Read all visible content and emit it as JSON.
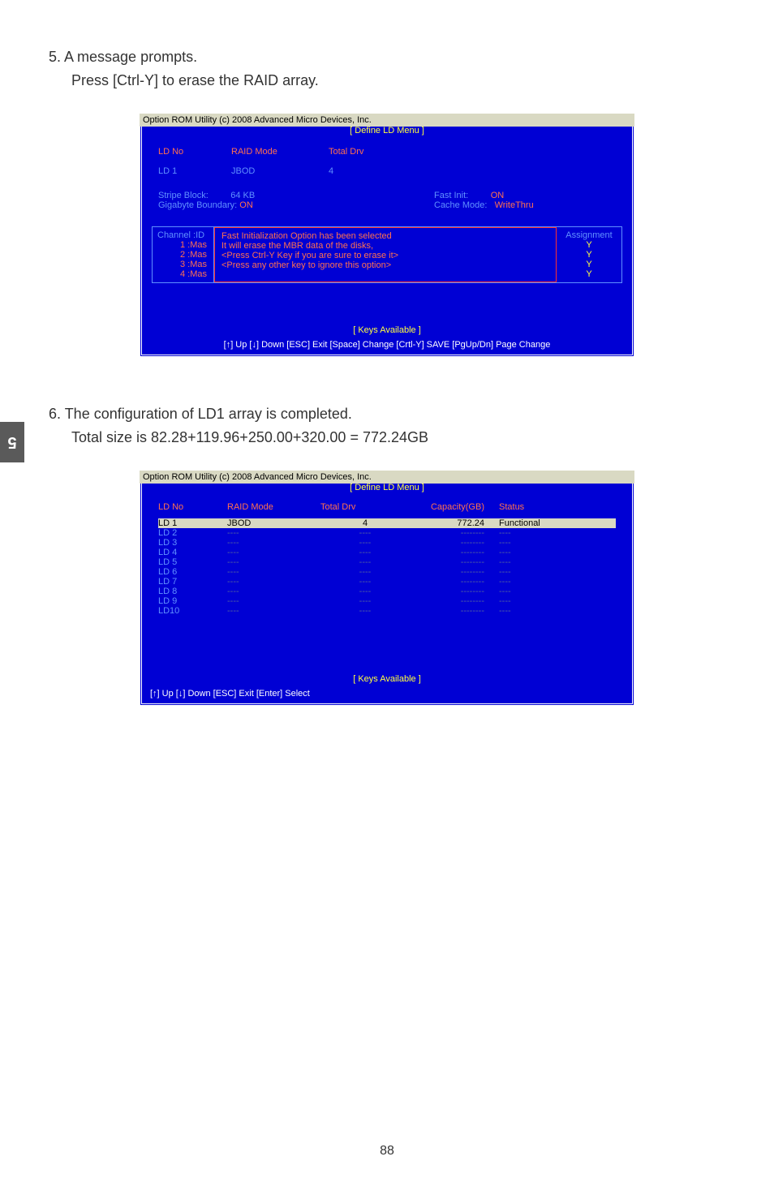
{
  "sideTab": "5",
  "step5": {
    "title": "5. A message prompts.",
    "instruction": "Press [Ctrl-Y] to erase the RAID array."
  },
  "bios1": {
    "title": "Option ROM Utility (c) 2008 Advanced Micro Devices, Inc.",
    "menuLabel": "[ Define LD Menu ]",
    "header": {
      "c1": "LD No",
      "c2": "RAID Mode",
      "c3": "Total Drv"
    },
    "row": {
      "c1": "LD  1",
      "c2": "JBOD",
      "c3": "4"
    },
    "settings": {
      "stripeLabel": "Stripe Block:",
      "stripeVal": "64   KB",
      "gigLabel": "Gigabyte Boundary:",
      "gigVal": "ON",
      "fastLabel": "Fast Init:",
      "fastVal": "ON",
      "cacheLabel": "Cache Mode:",
      "cacheVal": "WriteThru"
    },
    "channel": {
      "header": "Channel  :ID",
      "rows": [
        "1 :Mas",
        "2 :Mas",
        "3 :Mas",
        "4 :Mas"
      ]
    },
    "dialog": {
      "l1": "Fast Initialization Option has been selected",
      "l2": "It will erase the MBR data of the disks,",
      "l3": "<Press Ctrl-Y Key if you are sure to erase it>",
      "l4": "<Press any other key to ignore this option>"
    },
    "assign": {
      "header": "Assignment",
      "vals": [
        "Y",
        "Y",
        "Y",
        "Y"
      ]
    },
    "keysLabel": "[ Keys Available ]",
    "footer": "[↑] Up  [↓] Down  [ESC] Exit  [Space] Change  [Crtl-Y] SAVE   [PgUp/Dn] Page Change"
  },
  "step6": {
    "title": "6. The configuration of LD1 array is completed.",
    "instruction": "Total size is 82.28+119.96+250.00+320.00 = 772.24GB"
  },
  "bios2": {
    "title": "Option ROM Utility (c) 2008 Advanced Micro Devices, Inc.",
    "menuLabel": "[ Define LD Menu ]",
    "header": {
      "c1": "LD No",
      "c2": "RAID Mode",
      "c3": "Total Drv",
      "c4": "Capacity(GB)",
      "c5": "Status"
    },
    "rows": [
      {
        "id": "LD  1",
        "mode": "JBOD",
        "drv": "4",
        "cap": "772.24",
        "status": "Functional",
        "sel": true
      },
      {
        "id": "LD  2",
        "mode": "----",
        "drv": "----",
        "cap": "--------",
        "status": "----"
      },
      {
        "id": "LD  3",
        "mode": "----",
        "drv": "----",
        "cap": "--------",
        "status": "----"
      },
      {
        "id": "LD  4",
        "mode": "----",
        "drv": "----",
        "cap": "--------",
        "status": "----"
      },
      {
        "id": "LD  5",
        "mode": "----",
        "drv": "----",
        "cap": "--------",
        "status": "----"
      },
      {
        "id": "LD  6",
        "mode": "----",
        "drv": "----",
        "cap": "--------",
        "status": "----"
      },
      {
        "id": "LD  7",
        "mode": "----",
        "drv": "----",
        "cap": "--------",
        "status": "----"
      },
      {
        "id": "LD  8",
        "mode": "----",
        "drv": "----",
        "cap": "--------",
        "status": "----"
      },
      {
        "id": "LD  9",
        "mode": "----",
        "drv": "----",
        "cap": "--------",
        "status": "----"
      },
      {
        "id": "LD10",
        "mode": "----",
        "drv": "----",
        "cap": "--------",
        "status": "----"
      }
    ],
    "keysLabel": "[ Keys Available ]",
    "footer": "[↑] Up     [↓] Down     [ESC] Exit     [Enter] Select"
  },
  "pageNum": "88"
}
